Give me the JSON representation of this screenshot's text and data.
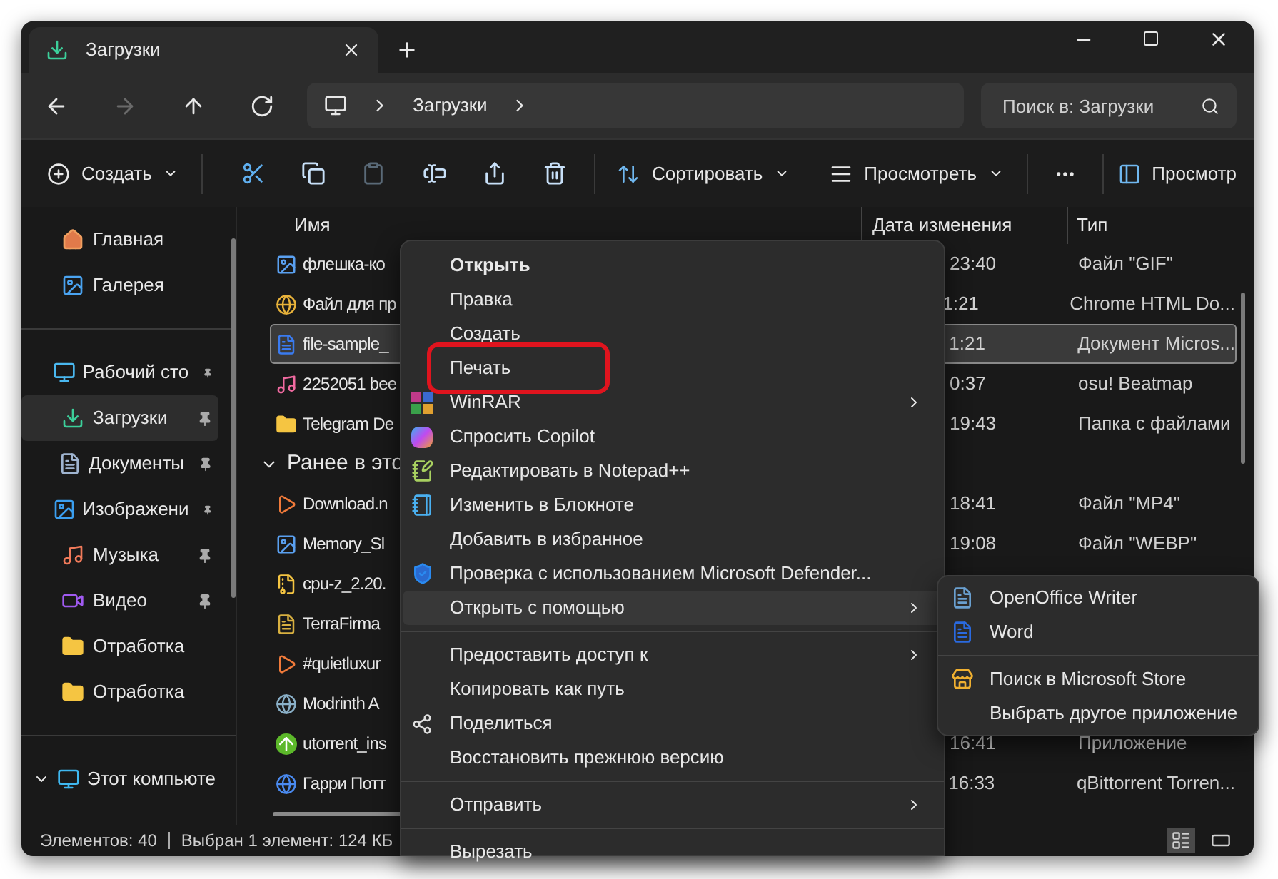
{
  "tab": {
    "title": "Загрузки",
    "selected": true
  },
  "nav_buttons": [
    {
      "disabled": false
    },
    {
      "disabled": true
    },
    {
      "disabled": false
    },
    {
      "disabled": false
    }
  ],
  "address": {
    "crumbs": [
      "Загрузки"
    ]
  },
  "search": {
    "placeholder": "Поиск в: Загрузки"
  },
  "toolbar": {
    "create": "Создать",
    "icon_buttons": [
      {
        "disabled": false
      },
      {
        "disabled": false
      },
      {
        "disabled": true
      },
      {
        "disabled": false
      },
      {
        "disabled": false
      },
      {
        "disabled": false
      }
    ],
    "sort": "Сортировать",
    "view": "Просмотреть",
    "preview": "Просмотр"
  },
  "sidebar": {
    "sections": [
      [
        {
          "label": "Главная",
          "kind": "home",
          "pinned": false,
          "selected": false
        },
        {
          "label": "Галерея",
          "kind": "gallery",
          "pinned": false,
          "selected": false
        }
      ],
      [
        {
          "label": "Рабочий сто",
          "kind": "desktop",
          "pinned": true,
          "selected": false
        },
        {
          "label": "Загрузки",
          "kind": "downloads",
          "pinned": true,
          "selected": true
        },
        {
          "label": "Документы",
          "kind": "documents",
          "pinned": true,
          "selected": false
        },
        {
          "label": "Изображени",
          "kind": "pictures",
          "pinned": true,
          "selected": false
        },
        {
          "label": "Музыка",
          "kind": "music",
          "pinned": true,
          "selected": false
        },
        {
          "label": "Видео",
          "kind": "video",
          "pinned": true,
          "selected": false
        },
        {
          "label": "Отработка",
          "kind": "folder",
          "pinned": false,
          "selected": false
        },
        {
          "label": "Отработка",
          "kind": "folder",
          "pinned": false,
          "selected": false
        }
      ],
      [
        {
          "label": "Этот компьюте",
          "kind": "computer",
          "pinned": false,
          "selected": false,
          "expanded": true
        }
      ]
    ]
  },
  "file_list": {
    "columns": [
      "Имя",
      "Дата изменения",
      "Тип"
    ],
    "groups": [
      {
        "files": [
          {
            "name": "флешка-ко",
            "date": "23:40",
            "type": "Файл \"GIF\"",
            "kind": "image",
            "selected": false
          },
          {
            "name": "Файл для пр",
            "date": "1:21",
            "type": "Chrome HTML Do...",
            "kind": "chrome",
            "selected": false
          },
          {
            "name": "file-sample_",
            "date": "1:21",
            "type": "Документ Micros...",
            "kind": "word",
            "selected": true
          },
          {
            "name": "2252051 bee",
            "date": "0:37",
            "type": "osu! Beatmap",
            "kind": "osu",
            "selected": false
          },
          {
            "name": "Telegram De",
            "date": "19:43",
            "type": "Папка с файлами",
            "kind": "folder",
            "selected": false
          }
        ]
      },
      {
        "title": "Ранее в это",
        "expanded": true,
        "files": [
          {
            "name": "Download.n",
            "date": "18:41",
            "type": "Файл \"MP4\"",
            "kind": "video",
            "selected": false
          },
          {
            "name": "Memory_Sl",
            "date": "19:08",
            "type": "Файл \"WEBP\"",
            "kind": "image",
            "selected": false
          },
          {
            "name": "cpu-z_2.20.",
            "kind": "archive",
            "selected": false
          },
          {
            "name": "TerraFirma",
            "kind": "app",
            "selected": false
          },
          {
            "name": "#quietluxur",
            "kind": "video",
            "selected": false
          },
          {
            "name": "Modrinth A",
            "kind": "globe",
            "selected": false
          },
          {
            "name": "utorrent_ins",
            "date": "16:41",
            "type": "Приложение",
            "kind": "utorrent",
            "selected": false
          },
          {
            "name": "Гарри Потт",
            "date": "16:33",
            "type": "qBittorrent Torren...",
            "kind": "torrent",
            "selected": false
          }
        ]
      }
    ]
  },
  "status_bar": {
    "count": "Элементов: 40",
    "selection": "Выбран 1 элемент: 124 КБ",
    "views": [
      {
        "kind": "details",
        "selected": true
      },
      {
        "kind": "tiles",
        "selected": false
      }
    ]
  },
  "context_menu": {
    "groups": [
      [
        {
          "label": "Открыть",
          "kind": "plain",
          "default": true,
          "submenu": false,
          "selected": false,
          "circled": false
        },
        {
          "label": "Правка",
          "kind": "plain",
          "default": false,
          "submenu": false,
          "selected": false,
          "circled": false
        },
        {
          "label": "Создать",
          "kind": "plain",
          "default": false,
          "submenu": false,
          "selected": false,
          "circled": false
        },
        {
          "label": "Печать",
          "kind": "plain",
          "default": false,
          "submenu": false,
          "selected": false,
          "circled": true
        },
        {
          "label": "WinRAR",
          "kind": "winrar",
          "default": false,
          "submenu": true,
          "selected": false,
          "circled": false
        },
        {
          "label": "Спросить Copilot",
          "kind": "copilot",
          "default": false,
          "submenu": false,
          "selected": false,
          "circled": false
        },
        {
          "label": "Редактировать в Notepad++",
          "kind": "notepadpp",
          "default": false,
          "submenu": false,
          "selected": false,
          "circled": false
        },
        {
          "label": "Изменить в Блокноте",
          "kind": "notepad",
          "default": false,
          "submenu": false,
          "selected": false,
          "circled": false
        },
        {
          "label": "Добавить в избранное",
          "kind": "plain",
          "default": false,
          "submenu": false,
          "selected": false,
          "circled": false
        },
        {
          "label": "Проверка с использованием Microsoft Defender...",
          "kind": "defender",
          "default": false,
          "submenu": false,
          "selected": false,
          "circled": false
        },
        {
          "label": "Открыть с помощью",
          "kind": "plain",
          "default": false,
          "submenu": true,
          "selected": true,
          "circled": false
        }
      ],
      [
        {
          "label": "Предоставить доступ к",
          "kind": "plain",
          "default": false,
          "submenu": true,
          "selected": false,
          "circled": false
        },
        {
          "label": "Копировать как путь",
          "kind": "plain",
          "default": false,
          "submenu": false,
          "selected": false,
          "circled": false
        },
        {
          "label": "Поделиться",
          "kind": "share",
          "default": false,
          "submenu": false,
          "selected": false,
          "circled": false
        },
        {
          "label": "Восстановить прежнюю версию",
          "kind": "plain",
          "default": false,
          "submenu": false,
          "selected": false,
          "circled": false
        }
      ],
      [
        {
          "label": "Отправить",
          "kind": "plain",
          "default": false,
          "submenu": true,
          "selected": false,
          "circled": false
        }
      ],
      [
        {
          "label": "Вырезать",
          "kind": "plain",
          "default": false,
          "submenu": false,
          "selected": false,
          "circled": false
        }
      ]
    ]
  },
  "open_with_menu": {
    "groups": [
      [
        {
          "label": "OpenOffice Writer",
          "kind": "writer"
        },
        {
          "label": "Word",
          "kind": "word"
        }
      ],
      [
        {
          "label": "Поиск в Microsoft Store",
          "kind": "store"
        },
        {
          "label": "Выбрать другое приложение",
          "kind": "plain"
        }
      ]
    ]
  }
}
